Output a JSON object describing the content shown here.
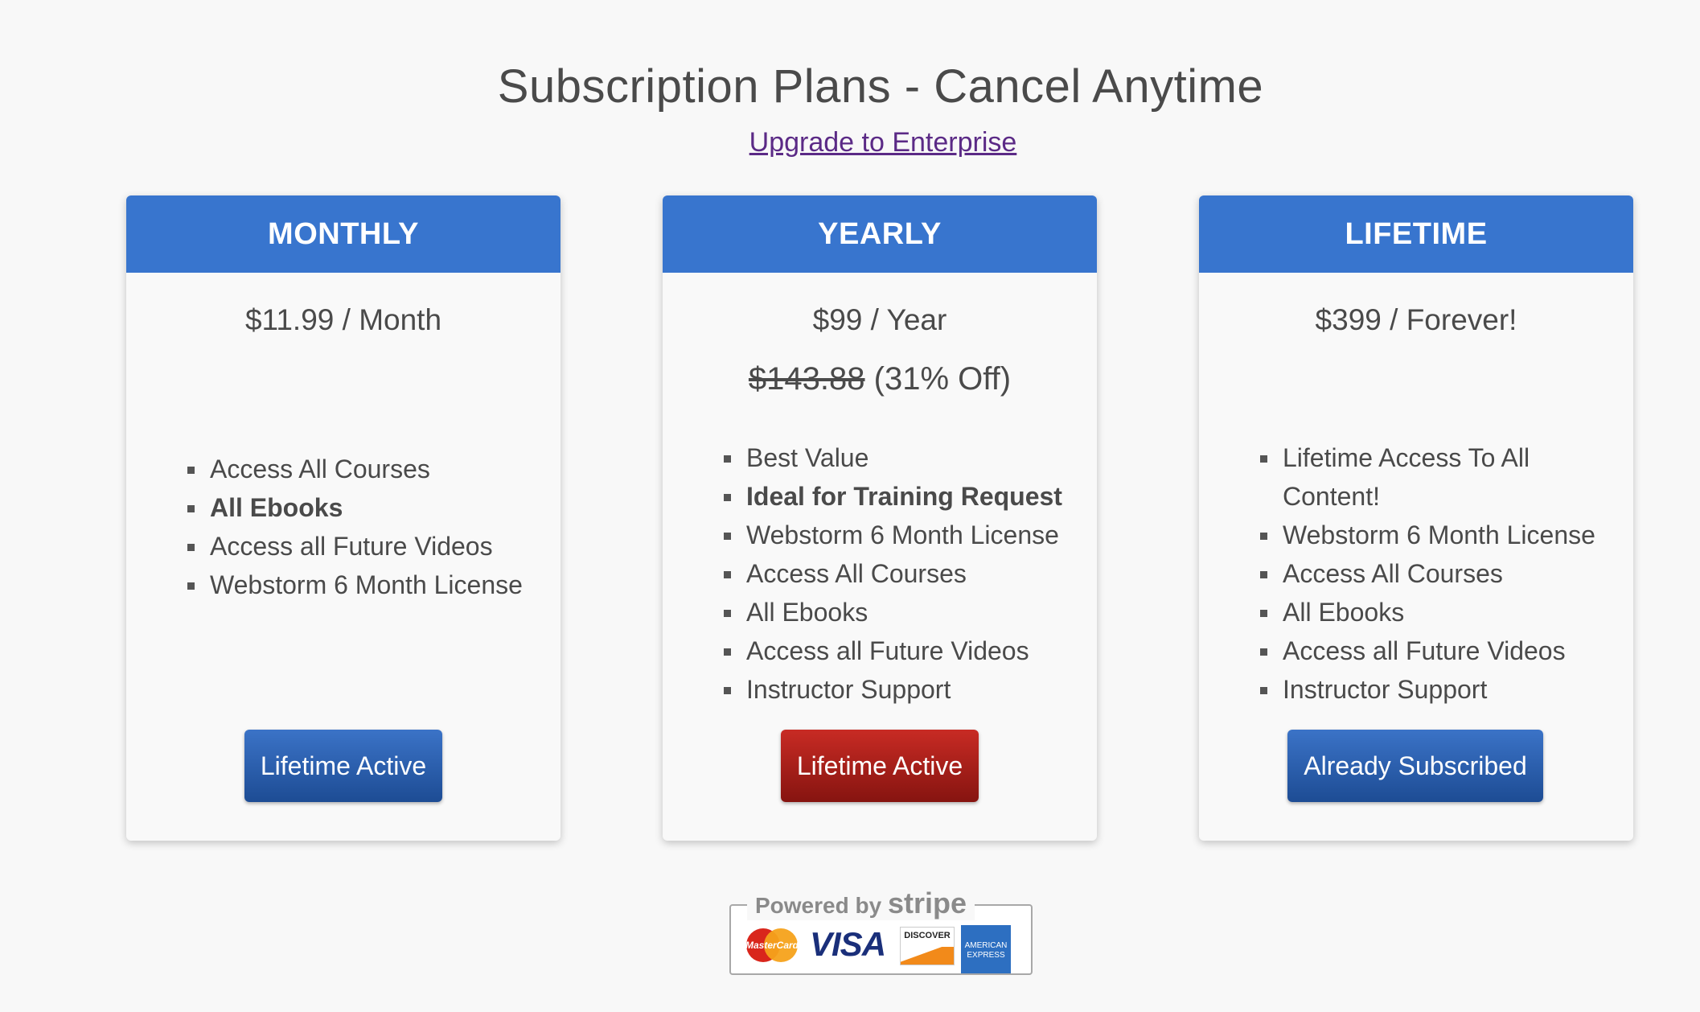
{
  "header": {
    "title": "Subscription Plans - Cancel Anytime",
    "enterprise_link": "Upgrade to Enterprise"
  },
  "plans": [
    {
      "name": "MONTHLY",
      "price": "$11.99  / Month",
      "features": [
        "Access All Courses",
        "All Ebooks",
        "Access all Future Videos",
        "Webstorm 6 Month License"
      ],
      "button": "Lifetime Active"
    },
    {
      "name": "YEARLY",
      "price": "$99 / Year",
      "original_price": "$143.88",
      "discount": " (31% Off)",
      "features": [
        "Best Value",
        "Ideal for Training Request",
        "Webstorm 6 Month License",
        "Access All Courses",
        "All Ebooks",
        "Access all Future Videos",
        "Instructor Support"
      ],
      "button": "Lifetime Active"
    },
    {
      "name": "LIFETIME",
      "price": "$399 / Forever!",
      "features": [
        "Lifetime Access To All Content!",
        "Webstorm 6 Month License",
        "Access All Courses",
        "All Ebooks",
        "Access all Future Videos",
        "Instructor Support"
      ],
      "button": "Already Subscribed"
    }
  ],
  "payment_badge": {
    "powered_by": "Powered by ",
    "brand": "stripe",
    "cards": {
      "mastercard": "MasterCard",
      "visa": "VISA",
      "discover": "DISCOVER",
      "amex": "AMERICAN EXPRESS"
    }
  },
  "colors": {
    "header_blue": "#3875ce",
    "button_blue": "#2a5fae",
    "button_red": "#b0201a",
    "link_purple": "#5b2a86"
  }
}
